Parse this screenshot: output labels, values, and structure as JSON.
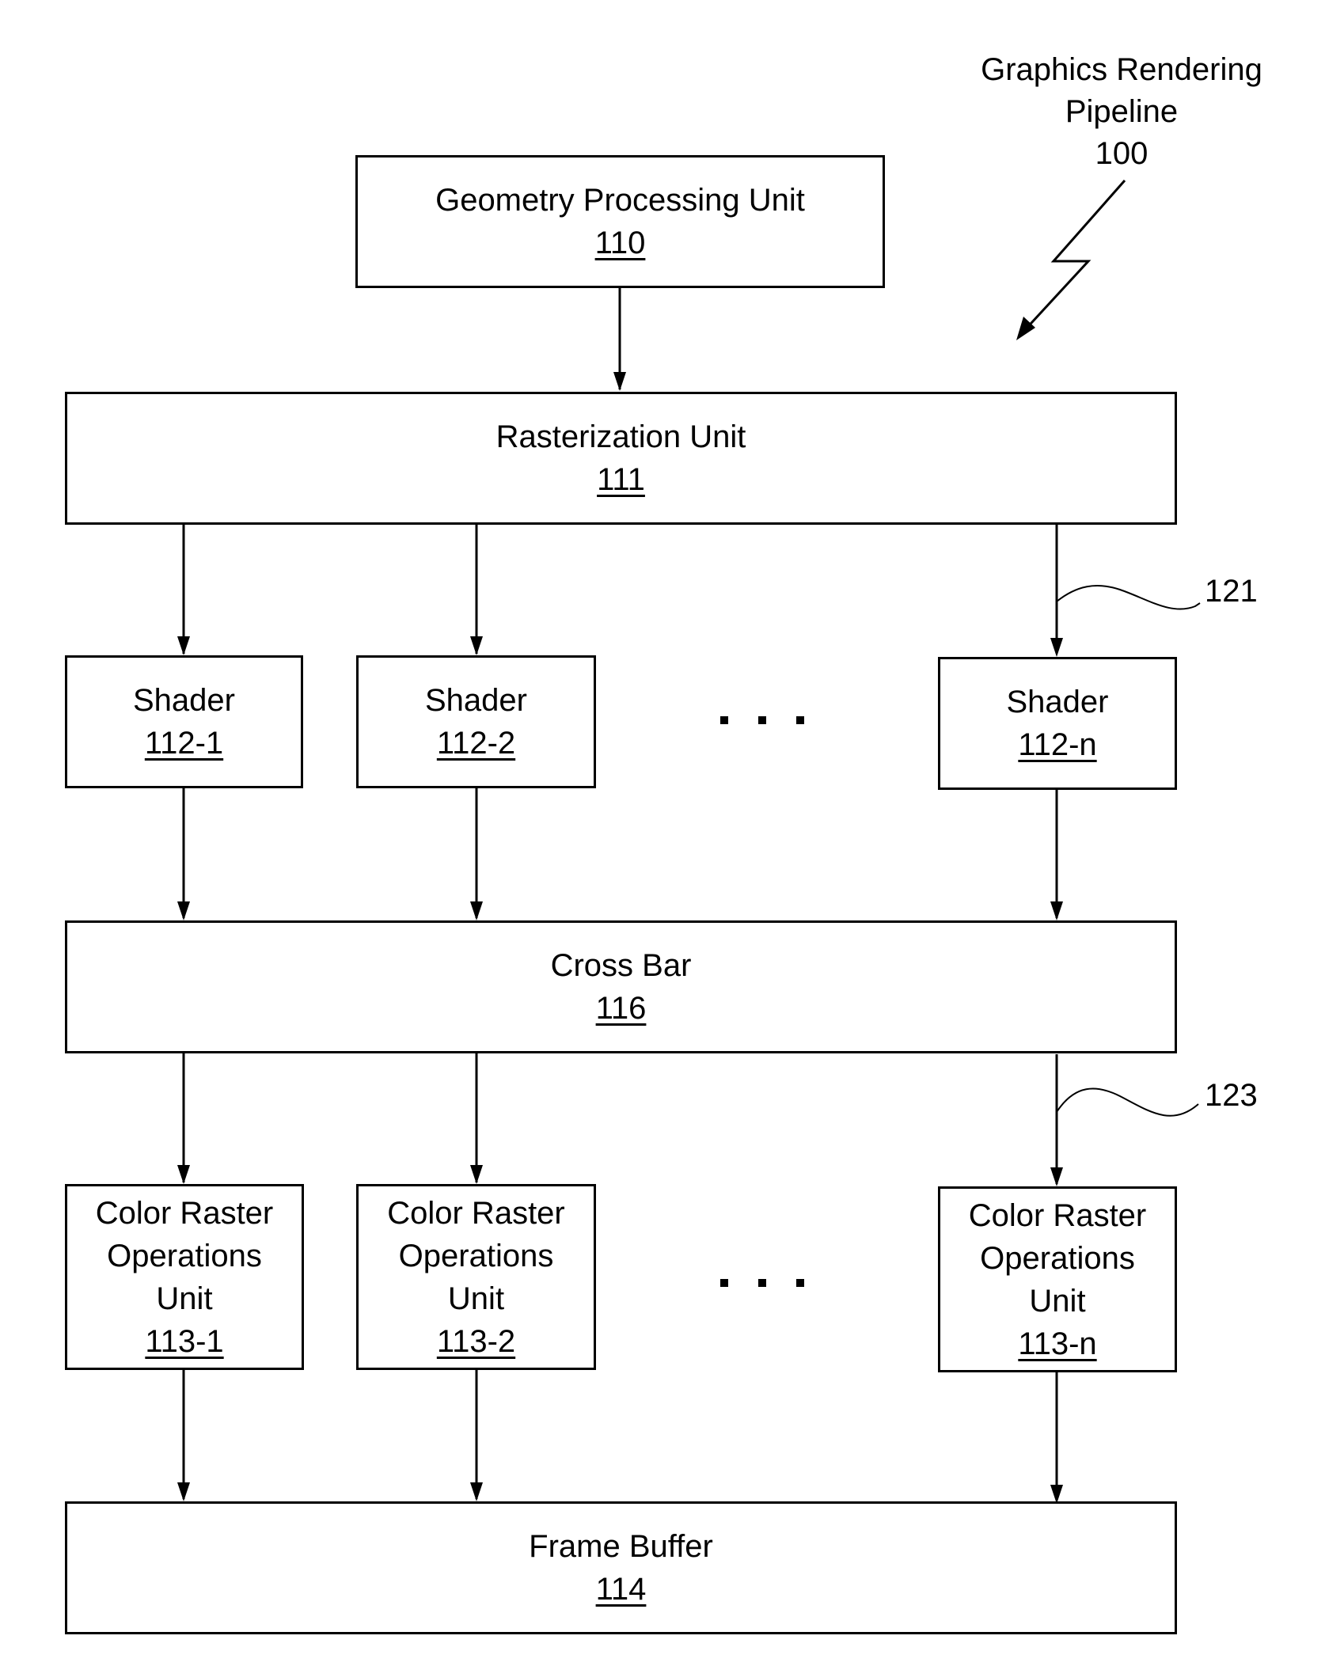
{
  "figure": {
    "title_lines": [
      "Graphics Rendering",
      "Pipeline",
      "100"
    ]
  },
  "blocks": {
    "geometry": {
      "name": "Geometry Processing Unit",
      "ref": "110"
    },
    "rasterization": {
      "name": "Rasterization Unit",
      "ref": "111"
    },
    "shaders": [
      {
        "name": "Shader",
        "ref": "112-1"
      },
      {
        "name": "Shader",
        "ref": "112-2"
      },
      {
        "name": "Shader",
        "ref": "112-n"
      }
    ],
    "crossbar": {
      "name": "Cross Bar",
      "ref": "116"
    },
    "crops": [
      {
        "name_lines": [
          "Color Raster",
          "Operations",
          "Unit"
        ],
        "ref": "113-1"
      },
      {
        "name_lines": [
          "Color Raster",
          "Operations",
          "Unit"
        ],
        "ref": "113-2"
      },
      {
        "name_lines": [
          "Color Raster",
          "Operations",
          "Unit"
        ],
        "ref": "113-n"
      }
    ],
    "framebuffer": {
      "name": "Frame Buffer",
      "ref": "114"
    }
  },
  "callouts": {
    "shader_link": "121",
    "crop_link": "123"
  },
  "ellipsis": "..."
}
